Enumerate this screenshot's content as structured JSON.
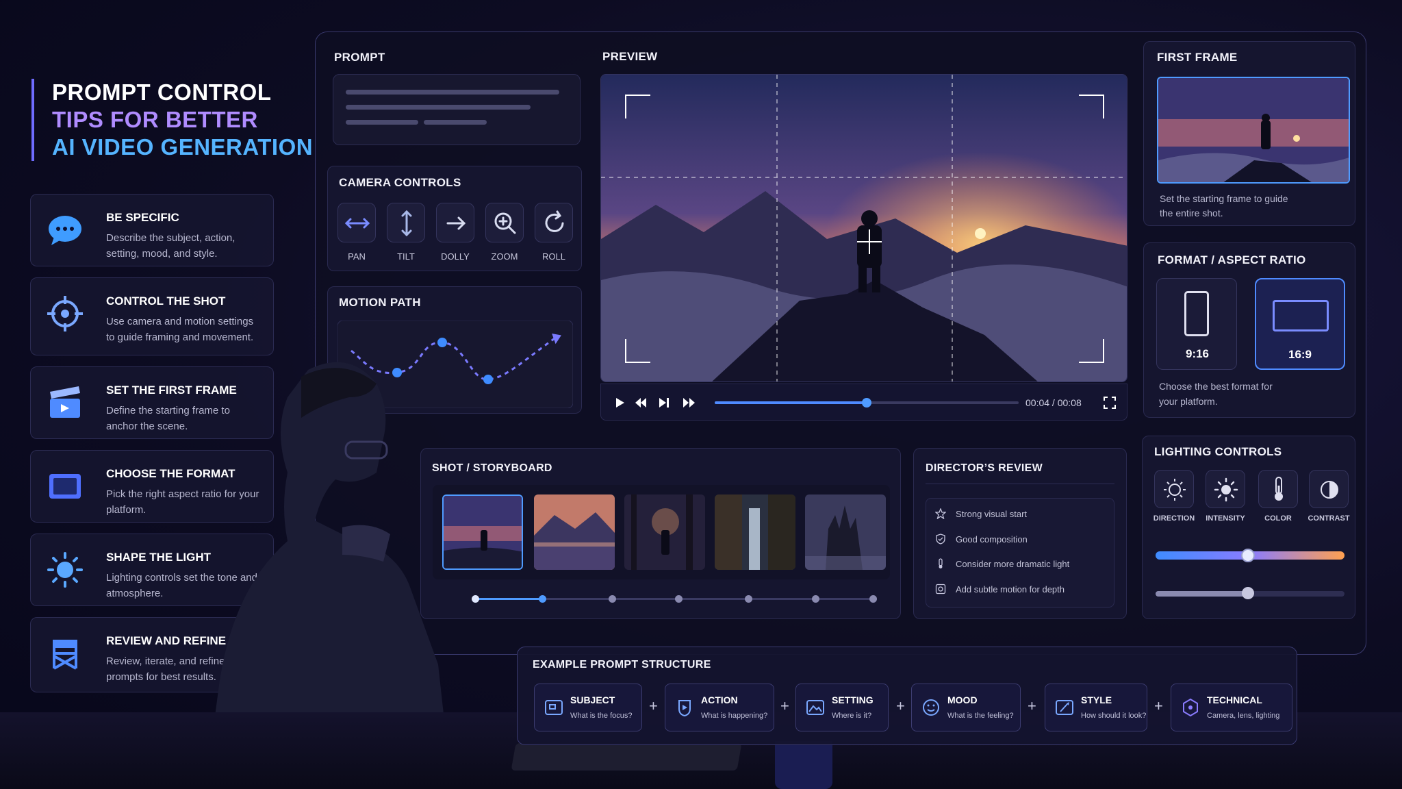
{
  "title": {
    "line1": "PROMPT CONTROL",
    "line2": "TIPS FOR BETTER",
    "line3": "AI VIDEO GENERATION"
  },
  "tips": [
    {
      "heading": "BE SPECIFIC",
      "desc": "Describe the subject, action, setting, mood, and style.",
      "icon": "chat-bubble-icon"
    },
    {
      "heading": "CONTROL THE SHOT",
      "desc": "Use camera and motion settings to guide framing and movement.",
      "icon": "crosshair-icon"
    },
    {
      "heading": "SET THE FIRST FRAME",
      "desc": "Define the starting frame to anchor the scene.",
      "icon": "clapperboard-icon"
    },
    {
      "heading": "CHOOSE THE FORMAT",
      "desc": "Pick the right aspect ratio for your platform.",
      "icon": "rectangle-icon"
    },
    {
      "heading": "SHAPE THE LIGHT",
      "desc": "Lighting controls set the tone and atmosphere.",
      "icon": "sun-icon"
    },
    {
      "heading": "REVIEW AND REFINE",
      "desc": "Review, iterate, and refine prompts for best results.",
      "icon": "directors-chair-icon"
    }
  ],
  "prompt": {
    "label": "PROMPT"
  },
  "camera": {
    "label": "CAMERA CONTROLS",
    "buttons": [
      {
        "label": "PAN",
        "icon": "horizontal-arrows-icon"
      },
      {
        "label": "TILT",
        "icon": "vertical-arrows-icon"
      },
      {
        "label": "DOLLY",
        "icon": "arrow-right-icon"
      },
      {
        "label": "ZOOM",
        "icon": "zoom-in-icon"
      },
      {
        "label": "ROLL",
        "icon": "rotate-icon"
      }
    ]
  },
  "motion": {
    "label": "MOTION PATH"
  },
  "preview": {
    "label": "PREVIEW",
    "time": "00:04 / 00:08",
    "progress": 0.5
  },
  "first_frame": {
    "label": "FIRST FRAME",
    "desc": "Set the starting frame to guide the entire shot."
  },
  "format": {
    "label": "FORMAT / ASPECT RATIO",
    "options": [
      {
        "label": "9:16",
        "selected": false
      },
      {
        "label": "16:9",
        "selected": true
      }
    ],
    "desc": "Choose the best format for your platform."
  },
  "storyboard": {
    "label": "SHOT / STORYBOARD",
    "selected_index": 0
  },
  "review": {
    "label": "DIRECTOR’S REVIEW",
    "items": [
      {
        "text": "Strong visual start",
        "icon": "star-icon"
      },
      {
        "text": "Good composition",
        "icon": "shield-check-icon"
      },
      {
        "text": "Consider more dramatic light",
        "icon": "thermometer-icon"
      },
      {
        "text": "Add subtle motion for depth",
        "icon": "motion-frame-icon"
      }
    ]
  },
  "lighting": {
    "label": "LIGHTING CONTROLS",
    "buttons": [
      {
        "label": "DIRECTION",
        "icon": "sun-direction-icon"
      },
      {
        "label": "INTENSITY",
        "icon": "sun-icon"
      },
      {
        "label": "COLOR",
        "icon": "thermometer-icon"
      },
      {
        "label": "CONTRAST",
        "icon": "contrast-icon"
      }
    ],
    "slider1": 0.49,
    "slider2": 0.49
  },
  "structure": {
    "label": "EXAMPLE PROMPT STRUCTURE",
    "items": [
      {
        "title": "SUBJECT",
        "sub": "What is the focus?",
        "icon": "subject-icon"
      },
      {
        "title": "ACTION",
        "sub": "What is happening?",
        "icon": "action-icon"
      },
      {
        "title": "SETTING",
        "sub": "Where is it?",
        "icon": "landscape-icon"
      },
      {
        "title": "MOOD",
        "sub": "What is the feeling?",
        "icon": "smile-icon"
      },
      {
        "title": "STYLE",
        "sub": "How should it look?",
        "icon": "brush-icon"
      },
      {
        "title": "TECHNICAL",
        "sub": "Camera, lens, lighting",
        "icon": "gem-icon"
      }
    ],
    "plus": "+"
  },
  "colors": {
    "accent": "#5b8cff",
    "purple": "#b08cff",
    "cyan": "#55b4ff",
    "sunset": "#ff9a4a"
  }
}
